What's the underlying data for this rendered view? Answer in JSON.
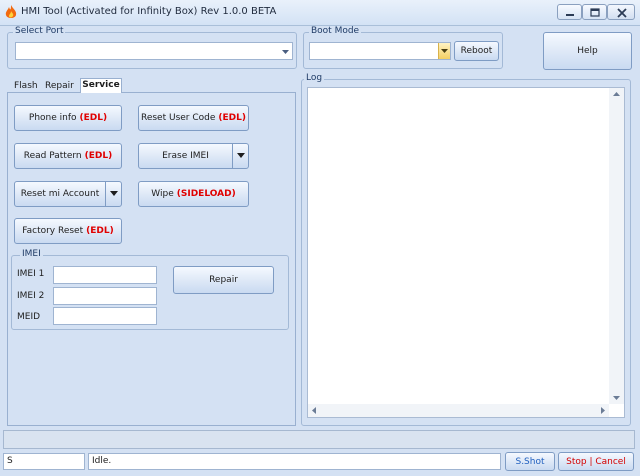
{
  "window": {
    "title": "HMI Tool (Activated for Infinity Box) Rev 1.0.0 BETA"
  },
  "select_port": {
    "legend": "Select Port",
    "value": ""
  },
  "boot_mode": {
    "legend": "Boot Mode",
    "value": "",
    "reboot_label": "Reboot"
  },
  "help_label": "Help",
  "tabs": [
    {
      "label": "Flash",
      "active": false
    },
    {
      "label": "Repair",
      "active": false
    },
    {
      "label": "Service",
      "active": true
    }
  ],
  "service": {
    "phone_info": {
      "label": "Phone info",
      "tag": "(EDL)"
    },
    "reset_user_code": {
      "label": "Reset User Code",
      "tag": "(EDL)"
    },
    "read_pattern": {
      "label": "Read Pattern",
      "tag": "(EDL)"
    },
    "erase_imei": {
      "label": "Erase IMEI"
    },
    "reset_mi_account": {
      "label": "Reset mi Account"
    },
    "wipe": {
      "label": "Wipe",
      "tag": "(SIDELOAD)"
    },
    "factory_reset": {
      "label": "Factory Reset",
      "tag": "(EDL)"
    }
  },
  "imei": {
    "legend": "IMEI",
    "imei1_label": "IMEI 1",
    "imei2_label": "IMEI 2",
    "meid_label": "MEID",
    "imei1_value": "",
    "imei2_value": "",
    "meid_value": "",
    "repair_label": "Repair"
  },
  "log": {
    "legend": "Log"
  },
  "status": {
    "left_text": "S",
    "status_text": "Idle.",
    "shot_label": "S.Shot",
    "stop_label": "Stop | Cancel"
  },
  "colors": {
    "tag_red": "#e00000",
    "link_blue": "#1f5fbf"
  },
  "icons": [
    "app-flame-icon",
    "minimize-icon",
    "maximize-icon",
    "close-icon",
    "dropdown-arrow-icon"
  ]
}
